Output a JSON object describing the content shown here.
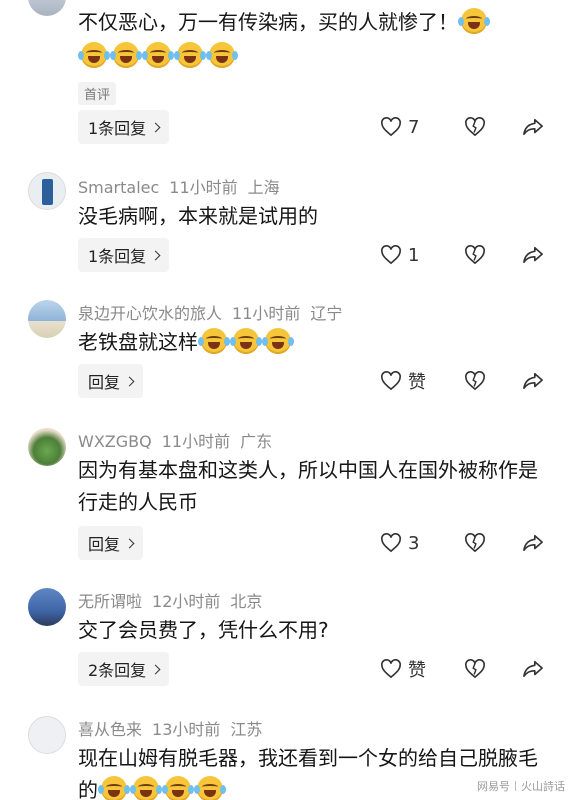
{
  "comments": [
    {
      "text": "不仅恶心，万一有传染病，买的人就惨了！",
      "badge": "首评",
      "reply_label": "1条回复",
      "like_count": "7"
    },
    {
      "user": "Smartalec",
      "time": "11小时前",
      "location": "上海",
      "text": "没毛病啊，本来就是试用的",
      "reply_label": "1条回复",
      "like_count": "1"
    },
    {
      "user": "泉边开心饮水的旅人",
      "time": "11小时前",
      "location": "辽宁",
      "text": "老铁盘就这样",
      "reply_label": "回复",
      "like_count": "赞"
    },
    {
      "user": "WXZGBQ",
      "time": "11小时前",
      "location": "广东",
      "text": "因为有基本盘和这类人，所以中国人在国外被称作是行走的人民币",
      "reply_label": "回复",
      "like_count": "3"
    },
    {
      "user": "无所谓啦",
      "time": "12小时前",
      "location": "北京",
      "text": "交了会员费了，凭什么不用?",
      "reply_label": "2条回复",
      "like_count": "赞"
    },
    {
      "user": "喜从色来",
      "time": "13小时前",
      "location": "江苏",
      "text": "现在山姆有脱毛器，我还看到一个女的给自己脱腋毛的"
    }
  ],
  "watermark": {
    "left": "网易号",
    "right": "火山詩话"
  },
  "icons": {
    "like": "heart-outline-icon",
    "dislike": "broken-heart-icon",
    "share": "share-arrow-icon",
    "emoji": "laughing-tears-emoji"
  }
}
